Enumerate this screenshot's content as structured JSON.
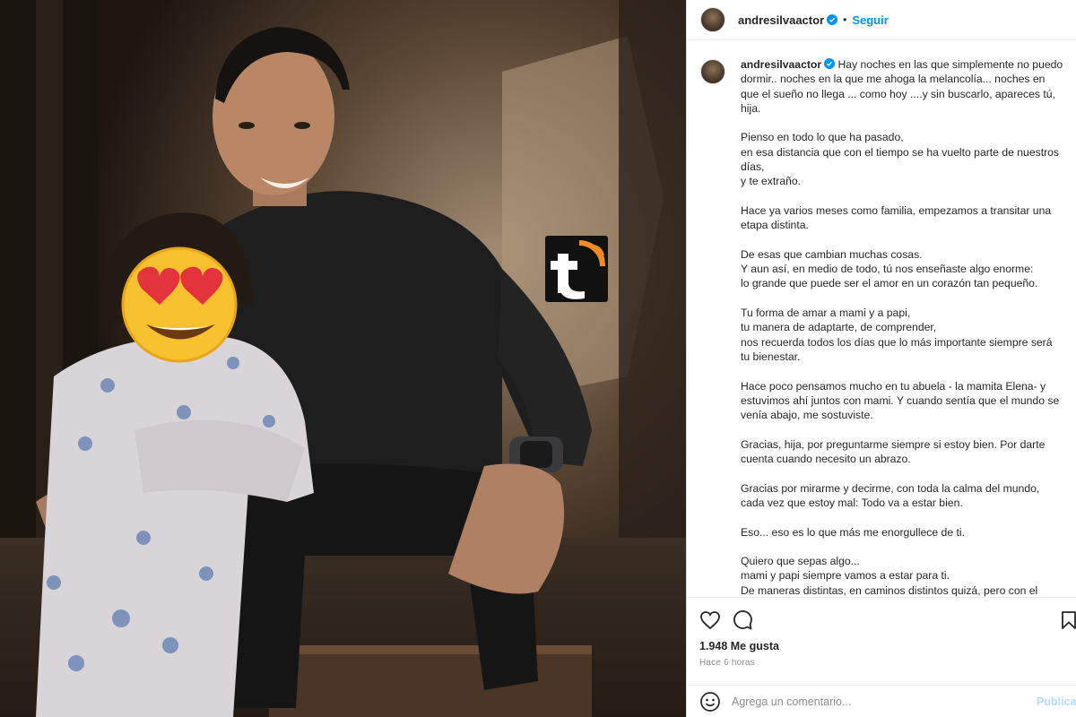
{
  "post": {
    "username": "andresilvaactor",
    "follow_label": "Seguir",
    "separator": "•",
    "verified": true
  },
  "caption": {
    "username": "andresilvaactor",
    "text": " Hay noches en las que simplemente no puedo dormir.. noches en la que me ahoga la melancolía... noches en que el sueño no llega ... como hoy ....y sin buscarlo, apareces tú, hija.\n\nPienso en todo lo que ha pasado,\nen esa distancia que con el tiempo se ha vuelto parte de nuestros días,\ny te extraño.\n\nHace ya varios meses como familia, empezamos a transitar una etapa distinta.\n\nDe esas que cambian muchas cosas.\nY aun así, en medio de todo, tú nos enseñaste algo enorme:\nlo grande que puede ser el amor en un corazón tan pequeño.\n\nTu forma de amar a mami y a papi,\ntu manera de adaptarte, de comprender,\nnos recuerda todos los días que lo más importante siempre será tu bienestar.\n\nHace poco pensamos mucho en tu abuela - la mamita Elena- y estuvimos ahí juntos con mami. Y cuando sentía que el mundo se venía abajo, me sostuviste.\n\nGracias, hija, por preguntarme siempre si estoy bien. Por darte cuenta cuando necesito un abrazo.\n\nGracias por mirarme y decirme, con toda la calma del mundo, cada vez que estoy mal: Todo va a estar bien.\n\nEso... eso es lo que más me enorgullece de ti.\n\nQuiero que sepas algo...\nmami y papi siempre vamos a estar para ti.\nDe maneras distintas, en caminos distintos quizá, pero con el"
  },
  "stats": {
    "likes": "1.948 Me gusta",
    "time": "Hace 6 horas"
  },
  "comment": {
    "placeholder": "Agrega un comentario...",
    "publish_label": "Publicar"
  },
  "icons": {
    "like": "heart-icon",
    "comment": "comment-icon",
    "save": "bookmark-icon",
    "emoji": "emoji-icon",
    "verified": "verified-badge-icon",
    "watermark": "t-logo-watermark"
  },
  "colors": {
    "link_blue": "#0095f6",
    "publish_disabled": "#b3dbff",
    "verified_blue": "#0095f6",
    "watermark_orange": "#f08a24"
  }
}
